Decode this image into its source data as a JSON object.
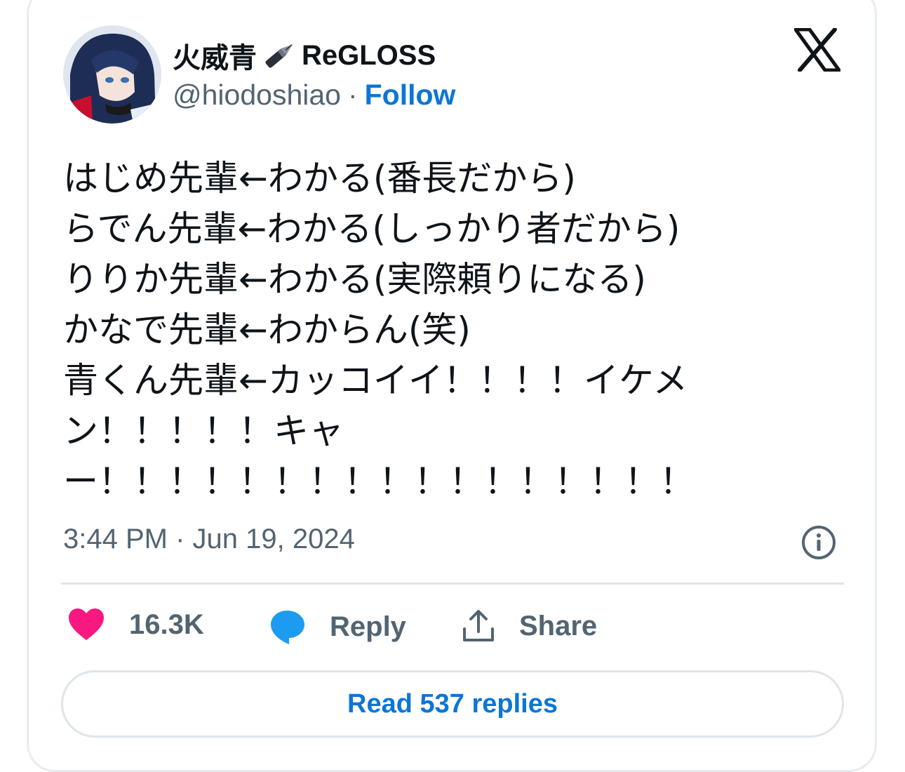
{
  "author": {
    "display_name": "火威青",
    "name_suffix": "ReGLOSS",
    "handle": "@hiodoshiao",
    "separator": "·",
    "follow_label": "Follow",
    "emoji_icon": "fountain-pen-icon"
  },
  "tweet": {
    "text": "はじめ先輩←わかる(番長だから)\nらでん先輩←わかる(しっかり者だから)\nりりか先輩←わかる(実際頼りになる)\nかなで先輩←わからん(笑)\n青くん先輩←カッコイイ！！！！イケメン！！！！！キャー！！！！！！！！！！！！！！！！！",
    "timestamp": "3:44 PM · Jun 19, 2024"
  },
  "actions": {
    "like_count": "16.3K",
    "reply_label": "Reply",
    "share_label": "Share"
  },
  "read_replies_label": "Read 537 replies",
  "colors": {
    "accent": "#0b76d6",
    "like": "#f91880",
    "reply_icon": "#1d9bf0",
    "muted": "#536471",
    "text": "#0f1419"
  }
}
